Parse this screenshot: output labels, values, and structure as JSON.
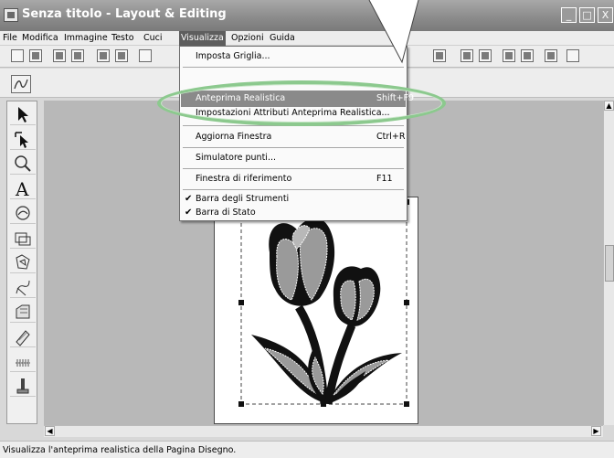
{
  "window": {
    "title": "Senza titolo - Layout & Editing",
    "buttons": {
      "minimize": "_",
      "maximize": "□",
      "close": "X"
    }
  },
  "menubar": {
    "items": [
      "File",
      "Modifica",
      "Immagine",
      "Testo",
      "Cuci",
      "Visualizza",
      "Opzioni",
      "Guida"
    ],
    "active": "Visualizza"
  },
  "dropdown": {
    "items": [
      {
        "label": "Imposta Griglia...",
        "shortcut": ""
      },
      {
        "label": "Anteprima Realistica",
        "shortcut": "Shift+F9",
        "highlighted": true
      },
      {
        "label": "Impostazioni Attributi Anteprima Realistica...",
        "shortcut": ""
      },
      {
        "label": "Aggiorna Finestra",
        "shortcut": "Ctrl+R"
      },
      {
        "label": "Simulatore punti...",
        "shortcut": ""
      },
      {
        "label": "Finestra di riferimento",
        "shortcut": "F11"
      },
      {
        "label": "Barra degli Strumenti",
        "shortcut": "",
        "checked": true
      },
      {
        "label": "Barra di Stato",
        "shortcut": "",
        "checked": true
      }
    ]
  },
  "tools": [
    "select-arrow-icon",
    "point-edit-icon",
    "zoom-icon",
    "text-icon",
    "circle-arc-icon",
    "rectangle-icon",
    "outline-shape-icon",
    "stitch-icon",
    "fill-icon",
    "stamp-icon",
    "stitch-pattern-icon",
    "hoop-icon"
  ],
  "status": {
    "text": "Visualizza l'anteprima realistica della Pagina Disegno."
  },
  "colors": {
    "highlight": "#8a8a8a",
    "callout": "#8cc98e",
    "titlebar": "#8a8a8a"
  }
}
